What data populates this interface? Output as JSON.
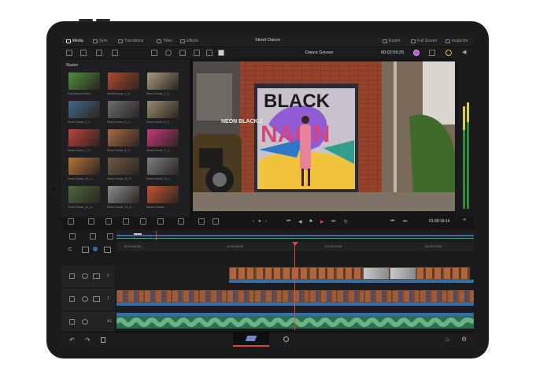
{
  "top_nav": {
    "media": "Media",
    "sync": "Sync",
    "transitions": "Transitions",
    "titles": "Titles",
    "effects": "Effects",
    "project_title": "Street Dance",
    "export": "Export",
    "full_screen": "Full Screen",
    "inspector": "Inspector"
  },
  "viewer_bar": {
    "clip_name": "Dance Groove",
    "timecode": "00:02:59:25"
  },
  "media_pool": {
    "header": "Master",
    "clips": [
      {
        "label": "Grid Dancers Red...",
        "color": "#4f8f3a"
      },
      {
        "label": "Street Dance_1_1...",
        "color": "#b24a2a"
      },
      {
        "label": "Street Dance_3_1...",
        "color": "#a89b7c"
      },
      {
        "label": "Street Dance_4_1...",
        "color": "#3f6b8a"
      },
      {
        "label": "Street Dance_5_1...",
        "color": "#6b6e72"
      },
      {
        "label": "Street Dance_6_1...",
        "color": "#9b8a6f"
      },
      {
        "label": "Street Dance_7_1...",
        "color": "#c0433c"
      },
      {
        "label": "Street Dance_8_1...",
        "color": "#a86a4a"
      },
      {
        "label": "Street Dance_9_1...",
        "color": "#c63a7c"
      },
      {
        "label": "Street Dance_10_1...",
        "color": "#b87438"
      },
      {
        "label": "Street Dance_11_1...",
        "color": "#6e5b45"
      },
      {
        "label": "Street Dance_12_1...",
        "color": "#7a7f86"
      },
      {
        "label": "Street Dance_12_1...",
        "color": "#4c6a3c"
      },
      {
        "label": "Street Dance_13_1...",
        "color": "#8a8d8f"
      },
      {
        "label": "Dance Groove",
        "color": "#c5532f"
      }
    ]
  },
  "transport": {
    "timecode": "01:00:19:14"
  },
  "timeline": {
    "ruler": [
      "01:00:06:00",
      "01:00:16:00",
      "01:00:20:00",
      "01:00:22:00"
    ],
    "tracks": [
      {
        "label": "2"
      },
      {
        "label": "1"
      },
      {
        "label": "A1"
      }
    ]
  },
  "colors": {
    "accent_red": "#e0463a",
    "audio_green": "#3fa86b",
    "timeline_blue": "#2f6fb0",
    "clip_orange": "#b2643a"
  }
}
